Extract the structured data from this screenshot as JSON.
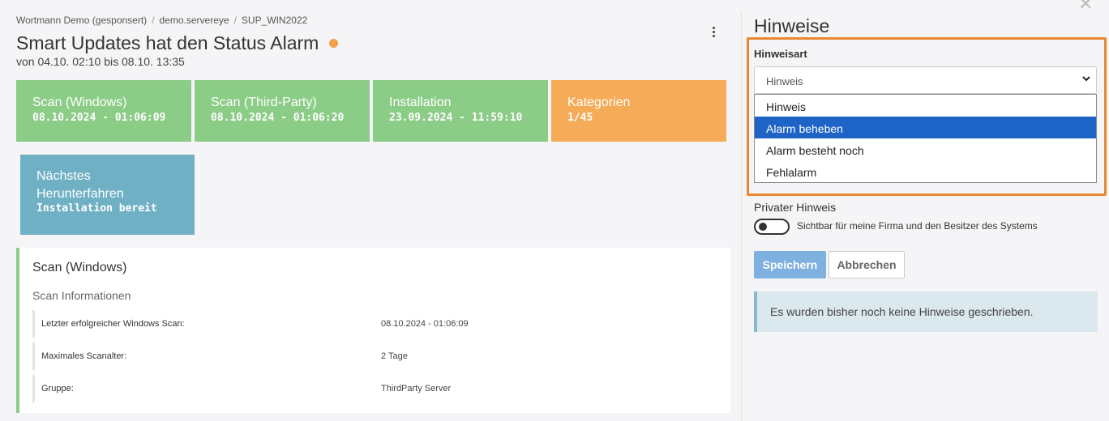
{
  "breadcrumb": [
    "Wortmann Demo (gesponsert)",
    "demo.servereye",
    "SUP_WIN2022"
  ],
  "breadcrumb_separator": "/",
  "header": {
    "title": "Smart Updates hat den Status Alarm",
    "status_color": "#f0a14a",
    "subtitle": "von 04.10. 02:10 bis 08.10. 13:35",
    "menu_icon": "kebab-menu-icon"
  },
  "tiles": [
    {
      "label": "Scan (Windows)",
      "value": "08.10.2024 - 01:06:09",
      "color": "#8bcc87"
    },
    {
      "label": "Scan (Third-Party)",
      "value": "08.10.2024 - 01:06:20",
      "color": "#8bcc87"
    },
    {
      "label": "Installation",
      "value": "23.09.2024 - 11:59:10",
      "color": "#8bcc87"
    },
    {
      "label": "Kategorien",
      "value": "1/45",
      "color": "#f6ab58"
    },
    {
      "label_line1": "Nächstes",
      "label_line2": "Herunterfahren",
      "value": "Installation bereit",
      "color": "#6fb0c4"
    }
  ],
  "card": {
    "title": "Scan (Windows)",
    "subtitle": "Scan Informationen",
    "rows": [
      {
        "key": "Letzter erfolgreicher Windows Scan:",
        "value": "08.10.2024 - 01:06:09"
      },
      {
        "key": "Maximales Scanalter:",
        "value": "2 Tage"
      },
      {
        "key": "Gruppe:",
        "value": "ThirdParty Server"
      }
    ]
  },
  "hinweise": {
    "title": "Hinweise",
    "close_icon": "close-icon",
    "type_label": "Hinweisart",
    "selected_value": "Hinweis",
    "options": [
      "Hinweis",
      "Alarm beheben",
      "Alarm besteht noch",
      "Fehlalarm"
    ],
    "highlighted_option": "Alarm beheben",
    "private_label": "Privater Hinweis",
    "private_description": "Sichtbar für meine Firma und den Besitzer des Systems",
    "private_enabled": false,
    "save_label": "Speichern",
    "cancel_label": "Abbrechen",
    "empty_notice": "Es wurden bisher noch keine Hinweise geschrieben.",
    "highlight_color": "#e9882e",
    "accent_color": "#1d64c6"
  }
}
